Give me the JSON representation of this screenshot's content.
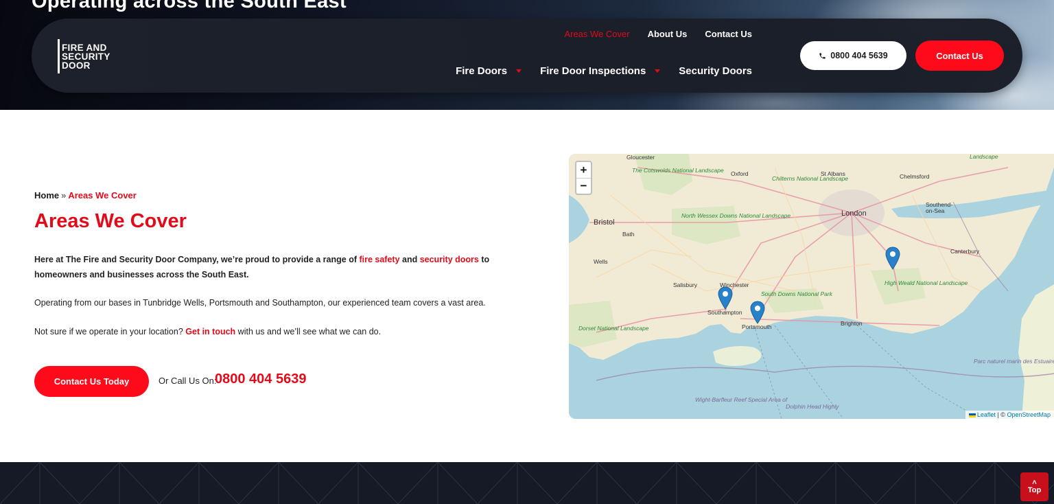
{
  "hero": {
    "title": "Operating across the South East"
  },
  "nav": {
    "logo_lines": [
      "FIRE AND",
      "SECURITY",
      "DOOR"
    ],
    "top_links": [
      "Areas We Cover",
      "About Us",
      "Contact Us"
    ],
    "main_links": [
      "Fire Doors",
      "Fire Door Inspections",
      "Security Doors"
    ],
    "phone": "0800 404 5639",
    "contact": "Contact Us"
  },
  "breadcrumb": {
    "home": "Home",
    "sep": "»",
    "current": "Areas We Cover"
  },
  "heading": "Areas We Cover",
  "lead": {
    "t1": "Here at The Fire and Security Door Company, we’re proud to provide a range of ",
    "link1": "fire safety",
    "t2": " and ",
    "link2": "security doors",
    "t3": " to homeowners and businesses across the South East."
  },
  "p2": "Operating from our bases in Tunbridge Wells, Portsmouth and Southampton, our experienced team covers a vast area.",
  "p3": {
    "t1": "Not sure if we operate in your location? ",
    "link": "Get in touch",
    "t2": " with us and we’ll see what we can do."
  },
  "cta": {
    "button": "Contact Us Today",
    "call_label": "Or Call Us On:",
    "call_number": "0800 404 5639"
  },
  "map": {
    "zoom_in": "+",
    "zoom_out": "−",
    "attribution_leaflet": "Leaflet",
    "attribution_sep": "| ©",
    "attribution_osm": "OpenStreetMap",
    "places": [
      "Gloucester",
      "Oxford",
      "St Albans",
      "Chelmsford",
      "Bristol",
      "Bath",
      "Wells",
      "London",
      "Southend-on-Sea",
      "Canterbury",
      "Salisbury",
      "Winchester",
      "Southampton",
      "Portsmouth",
      "Brighton"
    ],
    "parks": [
      "The Cotswolds National Landscape",
      "North Wessex Downs National Landscape",
      "Chilterns National Landscape",
      "South Downs National Park",
      "High Weald National Landscape",
      "Dorset National Landscape",
      "Landscape",
      "Parc naturel marin des Estuaires picards et de la mer d'Opale",
      "Wight-Barfleur Reef Special Area of",
      "Dolphin Head Highly"
    ]
  },
  "top_button": "Top",
  "colors": {
    "brand_red": "#e30b19",
    "nav_bg": "#1e222c",
    "footer_bg": "#161a27",
    "sea": "#aad3df",
    "land": "#f0ead8",
    "marker": "#2a81cb"
  }
}
